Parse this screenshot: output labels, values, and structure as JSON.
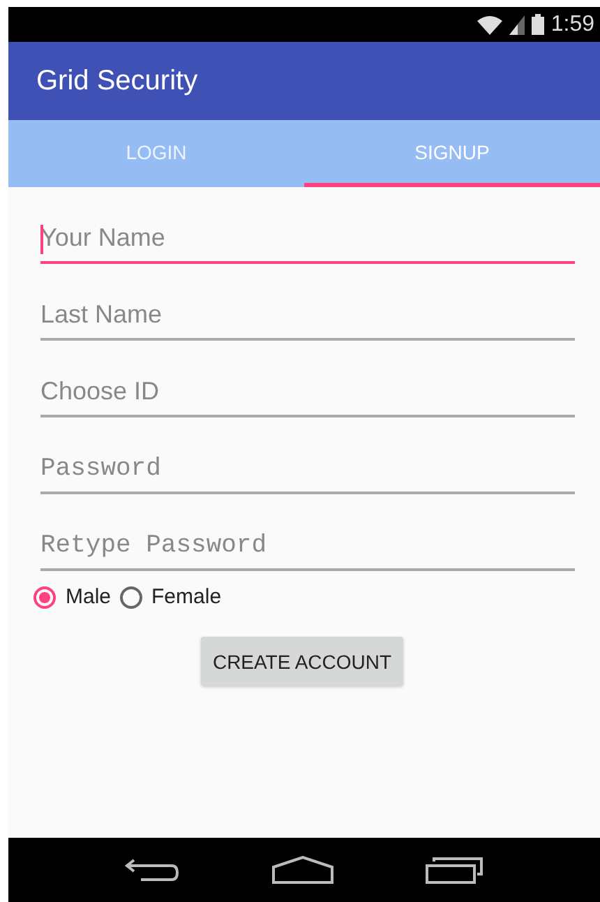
{
  "status_bar": {
    "time": "1:59"
  },
  "app_bar": {
    "title": "Grid Security"
  },
  "tabs": [
    {
      "label": "LOGIN",
      "selected": false
    },
    {
      "label": "SIGNUP",
      "selected": true
    }
  ],
  "fields": [
    {
      "placeholder": "Your Name",
      "kind": "text",
      "focused": true
    },
    {
      "placeholder": "Last Name",
      "kind": "text",
      "focused": false
    },
    {
      "placeholder": "Choose ID",
      "kind": "text",
      "focused": false
    },
    {
      "placeholder": "Password",
      "kind": "password",
      "focused": false
    },
    {
      "placeholder": "Retype Password",
      "kind": "password",
      "focused": false
    }
  ],
  "gender": [
    {
      "label": "Male",
      "selected": true
    },
    {
      "label": "Female",
      "selected": false
    }
  ],
  "button": {
    "label": "CREATE ACCOUNT"
  }
}
